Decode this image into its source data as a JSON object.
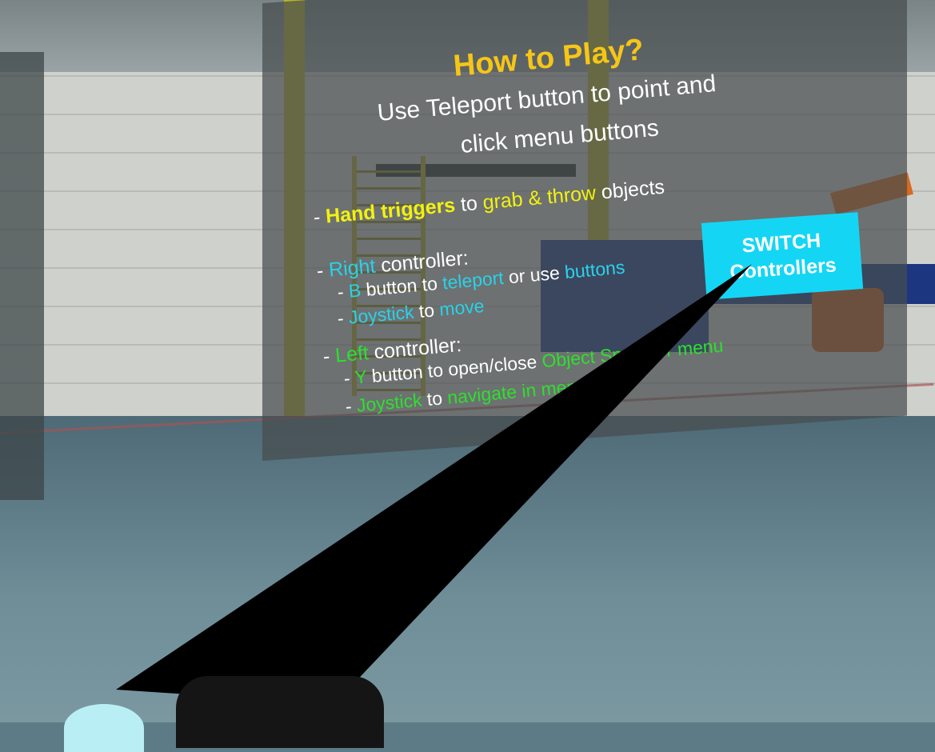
{
  "menu": {
    "title": "How to Play?",
    "intro_line1": "Use Teleport button to point and",
    "intro_line2": "click menu buttons",
    "hand": {
      "dash": "- ",
      "triggers": "Hand triggers",
      "to": " to ",
      "action": "grab & throw",
      "objects": " objects"
    },
    "right": {
      "dash": "- ",
      "label": "Right",
      "controller": " controller:",
      "b_dash": "- ",
      "b": "B",
      "b_text": " button to ",
      "teleport": "teleport",
      "or_use": " or use ",
      "buttons": "buttons",
      "js_dash": "- ",
      "joystick": "Joystick",
      "js_to": " to ",
      "move": "move"
    },
    "left": {
      "dash": "- ",
      "label": "Left",
      "controller": " controller:",
      "y_dash": "- ",
      "y": "Y",
      "y_text": " button to open/close ",
      "spawner": "Object Spawner menu",
      "js_dash": "- ",
      "joystick": "Joystick",
      "js_to": " to ",
      "navigate": "navigate in menu"
    },
    "switch_button": {
      "line1": "SWITCH",
      "line2": "Controllers"
    }
  },
  "colors": {
    "title": "#f6c617",
    "highlight_yellow": "#f2f20f",
    "highlight_cyan": "#29d2ea",
    "highlight_green": "#2ee02e",
    "button": "#14d6f4"
  }
}
